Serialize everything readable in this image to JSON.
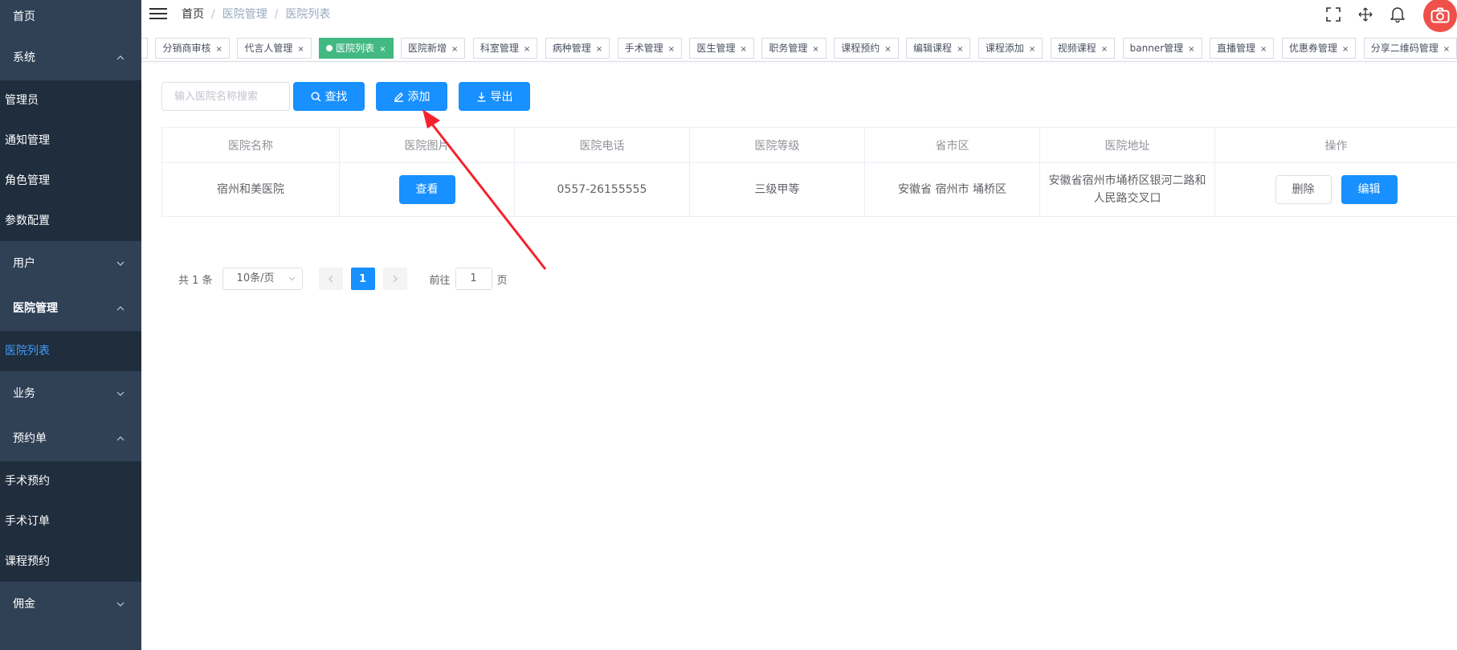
{
  "sidebar": {
    "items": [
      {
        "label": "首页",
        "type": "item"
      },
      {
        "label": "系统",
        "type": "group",
        "expanded": true
      },
      {
        "label": "管理员",
        "type": "sub"
      },
      {
        "label": "通知管理",
        "type": "sub"
      },
      {
        "label": "角色管理",
        "type": "sub"
      },
      {
        "label": "参数配置",
        "type": "sub"
      },
      {
        "label": "用户",
        "type": "group",
        "expanded": false
      },
      {
        "label": "医院管理",
        "type": "group",
        "expanded": true
      },
      {
        "label": "医院列表",
        "type": "sub",
        "active": true
      },
      {
        "label": "业务",
        "type": "group",
        "expanded": false
      },
      {
        "label": "预约单",
        "type": "group",
        "expanded": true
      },
      {
        "label": "手术预约",
        "type": "sub"
      },
      {
        "label": "手术订单",
        "type": "sub"
      },
      {
        "label": "课程预约",
        "type": "sub"
      },
      {
        "label": "佣金",
        "type": "group",
        "expanded": false
      }
    ]
  },
  "header": {
    "breadcrumb": [
      "首页",
      "医院管理",
      "医院列表"
    ],
    "icons": [
      "fullscreen-icon",
      "move-icon",
      "bell-icon",
      "camera-icon"
    ]
  },
  "tags": [
    {
      "label": "分销商审核"
    },
    {
      "label": "代言人管理"
    },
    {
      "label": "医院列表",
      "active": true
    },
    {
      "label": "医院新增"
    },
    {
      "label": "科室管理"
    },
    {
      "label": "病种管理"
    },
    {
      "label": "手术管理"
    },
    {
      "label": "医生管理"
    },
    {
      "label": "职务管理"
    },
    {
      "label": "课程预约"
    },
    {
      "label": "编辑课程"
    },
    {
      "label": "课程添加"
    },
    {
      "label": "视频课程"
    },
    {
      "label": "banner管理"
    },
    {
      "label": "直播管理"
    },
    {
      "label": "优惠券管理"
    },
    {
      "label": "分享二维码管理"
    }
  ],
  "toolbar": {
    "search_placeholder": "输入医院名称搜索",
    "search_label": "查找",
    "add_label": "添加",
    "export_label": "导出"
  },
  "table": {
    "columns": [
      "医院名称",
      "医院图片",
      "医院电话",
      "医院等级",
      "省市区",
      "医院地址",
      "操作"
    ],
    "rows": [
      {
        "name": "宿州和美医院",
        "image_button": "查看",
        "phone": "0557-26155555",
        "level": "三级甲等",
        "region": "安徽省 宿州市 埇桥区",
        "address": "安徽省宿州市埇桥区银河二路和人民路交叉口",
        "delete_label": "删除",
        "edit_label": "编辑"
      }
    ]
  },
  "pagination": {
    "total": "共 1 条",
    "page_size": "10条/页",
    "current_page": "1",
    "goto_prefix": "前往",
    "goto_value": "1",
    "goto_suffix": "页"
  },
  "colors": {
    "sidebar_bg": "#304156",
    "submenu_bg": "#1f2d3d",
    "primary": "#1890ff",
    "active_tag": "#42b983",
    "annotation_arrow": "#f5222d",
    "avatar_bg": "#f0504a"
  }
}
